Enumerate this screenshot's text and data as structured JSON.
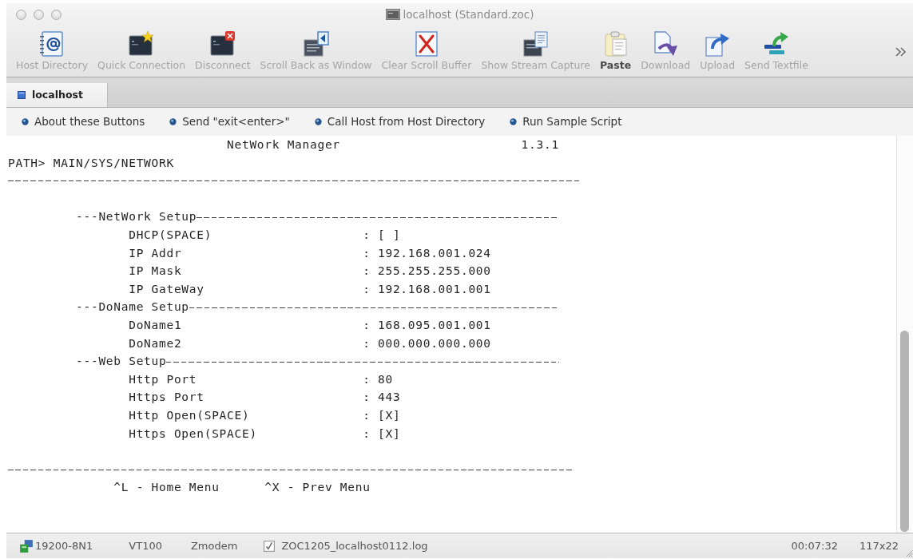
{
  "window": {
    "title": "localhost (Standard.zoc)"
  },
  "toolbar": {
    "items": [
      {
        "label": "Host Directory",
        "disabled": true
      },
      {
        "label": "Quick Connection",
        "disabled": true
      },
      {
        "label": "Disconnect",
        "disabled": true
      },
      {
        "label": "Scroll Back as Window",
        "disabled": true
      },
      {
        "label": "Clear Scroll Buffer",
        "disabled": true
      },
      {
        "label": "Show Stream Capture",
        "disabled": true
      },
      {
        "label": "Paste",
        "disabled": false
      },
      {
        "label": "Download",
        "disabled": true
      },
      {
        "label": "Upload",
        "disabled": true
      },
      {
        "label": "Send Textfile",
        "disabled": true
      }
    ]
  },
  "tabs": [
    {
      "label": "localhost",
      "selected": true
    }
  ],
  "button_bar": [
    "About these Buttons",
    "Send \"exit<enter>\"",
    "Call Host from Host Directory",
    "Run Sample Script"
  ],
  "terminal": {
    "title": "NetWork Manager",
    "version": "1.3.1",
    "path": "PATH> MAIN/SYS/NETWORK",
    "sections": [
      {
        "title": "---NetWork Setup",
        "fields": [
          {
            "label": "DHCP(SPACE)",
            "value": ": [ ]"
          },
          {
            "label": "IP Addr",
            "value": ": 192.168.001.024"
          },
          {
            "label": "IP Mask",
            "value": ": 255.255.255.000"
          },
          {
            "label": "IP GateWay",
            "value": ": 192.168.001.001"
          }
        ]
      },
      {
        "title": "---DoName Setup",
        "fields": [
          {
            "label": "DoName1",
            "value": ": 168.095.001.001"
          },
          {
            "label": "DoName2",
            "value": ": 000.000.000.000"
          }
        ]
      },
      {
        "title": "---Web Setup",
        "fields": [
          {
            "label": "Http Port",
            "value": ": 80"
          },
          {
            "label": "Https Port",
            "value": ": 443"
          },
          {
            "label": "Http Open(SPACE)",
            "value": ": [X]"
          },
          {
            "label": "Https Open(SPACE)",
            "value": ": [X]"
          }
        ]
      }
    ],
    "hints": [
      "^L - Home Menu",
      "^X - Prev Menu"
    ]
  },
  "status_bar": {
    "port": "19200-8N1",
    "emulation": "VT100",
    "transfer": "Zmodem",
    "log": {
      "file": "ZOC1205_localhost0112.log",
      "checked": true
    },
    "time": "00:07:32",
    "size": "117x22"
  }
}
